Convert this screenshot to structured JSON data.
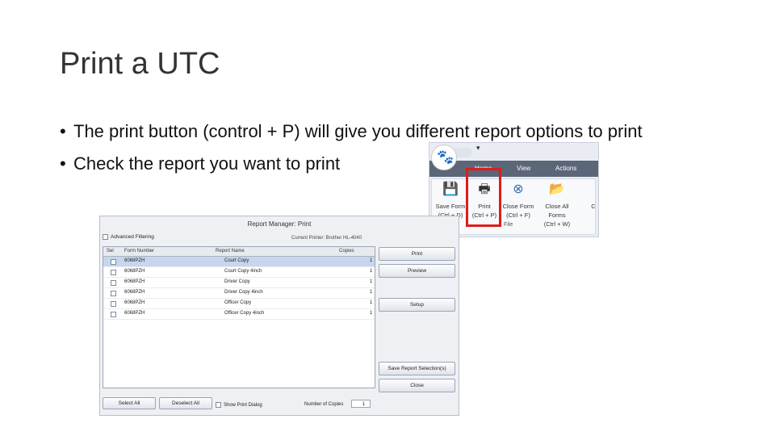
{
  "slide": {
    "title": "Print a UTC",
    "bullets": [
      "The print button (control + P) will give you different report options to print",
      "Check the report you want to print"
    ]
  },
  "ribbon": {
    "tabs": [
      "Home",
      "View",
      "Actions"
    ],
    "commands": [
      {
        "label": "Save Form",
        "shortcut": "(Ctrl + D)",
        "icon": "save-icon"
      },
      {
        "label": "Print",
        "shortcut": "(Ctrl + P)",
        "icon": "printer-icon"
      },
      {
        "label": "Close Form",
        "shortcut": "(Ctrl + F)",
        "icon": "close-form-icon"
      },
      {
        "label": "Close All Forms",
        "shortcut": "(Ctrl + W)",
        "icon": "folder-close-icon"
      },
      {
        "label": "C",
        "shortcut": "",
        "icon": ""
      }
    ],
    "group_label": "File",
    "highlight_color": "#e01b1b"
  },
  "dialog": {
    "title": "Report Manager: Print",
    "advanced_filtering": "Advanced Filtering",
    "current_printer": "Current Printer: Brother HL-4040",
    "columns": [
      "Sel",
      "Form Number",
      "Report Name",
      "Copies"
    ],
    "rows": [
      {
        "form": "6068PZH",
        "report": "Court Copy",
        "copies": "1"
      },
      {
        "form": "6068PZH",
        "report": "Court Copy 4inch",
        "copies": "1"
      },
      {
        "form": "6068PZH",
        "report": "Driver Copy",
        "copies": "1"
      },
      {
        "form": "6068PZH",
        "report": "Driver Copy 4inch",
        "copies": "1"
      },
      {
        "form": "6068PZH",
        "report": "Officer Copy",
        "copies": "1"
      },
      {
        "form": "6068PZH",
        "report": "Officer Copy 4inch",
        "copies": "1"
      }
    ],
    "buttons": {
      "print": "Print",
      "preview": "Preview",
      "setup": "Setup",
      "save_selection": "Save Report Selection(s)",
      "close": "Close",
      "select_all": "Select All",
      "deselect_all": "Deselect All"
    },
    "show_print_dialog": "Show Print Dialog",
    "number_of_copies_label": "Number of Copies",
    "number_of_copies": "1"
  }
}
